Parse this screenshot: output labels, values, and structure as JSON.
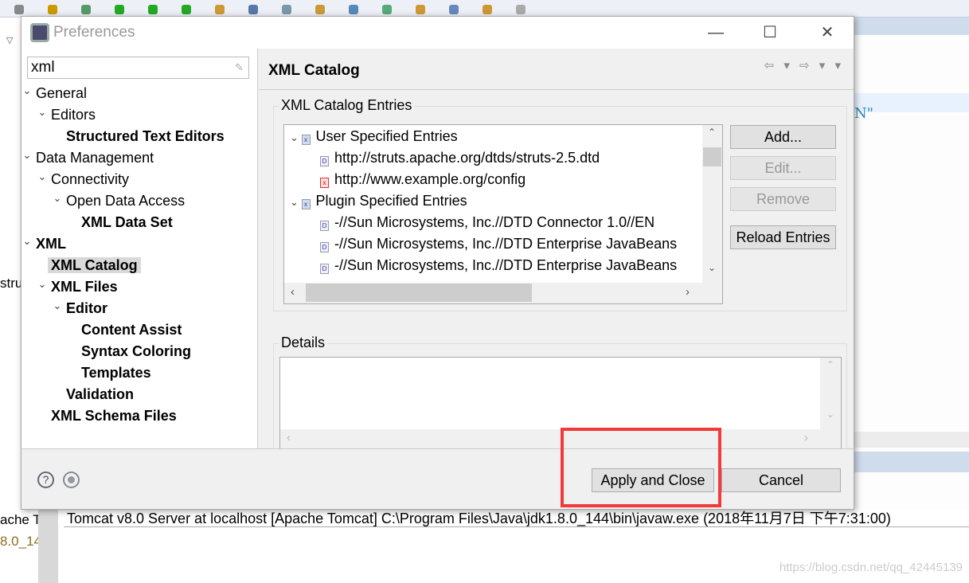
{
  "window": {
    "title": "Preferences",
    "minimize": "—",
    "maximize": "☐",
    "close": "✕"
  },
  "search": {
    "value": "xml"
  },
  "tree": [
    {
      "label": "General",
      "level": 0,
      "expanded": true,
      "bold": false
    },
    {
      "label": "Editors",
      "level": 1,
      "expanded": true,
      "bold": false
    },
    {
      "label": "Structured Text Editors",
      "level": 2,
      "bold": true
    },
    {
      "label": "Data Management",
      "level": 0,
      "expanded": true,
      "bold": false
    },
    {
      "label": "Connectivity",
      "level": 1,
      "expanded": true,
      "bold": false
    },
    {
      "label": "Open Data Access",
      "level": 2,
      "expanded": true,
      "bold": false
    },
    {
      "label": "XML Data Set",
      "level": 3,
      "bold": true
    },
    {
      "label": "XML",
      "level": 0,
      "expanded": true,
      "bold": true
    },
    {
      "label": "XML Catalog",
      "level": 1,
      "bold": true,
      "selected": true
    },
    {
      "label": "XML Files",
      "level": 1,
      "expanded": true,
      "bold": true
    },
    {
      "label": "Editor",
      "level": 2,
      "expanded": true,
      "bold": true
    },
    {
      "label": "Content Assist",
      "level": 3,
      "bold": true
    },
    {
      "label": "Syntax Coloring",
      "level": 3,
      "bold": true
    },
    {
      "label": "Templates",
      "level": 3,
      "bold": true
    },
    {
      "label": "Validation",
      "level": 2,
      "bold": true
    },
    {
      "label": "XML Schema Files",
      "level": 1,
      "bold": true
    }
  ],
  "page": {
    "title": "XML Catalog",
    "nav": "⇦ ▾ ⇨ ▾ ▾"
  },
  "catalog": {
    "group_label": "XML Catalog Entries",
    "entries": [
      {
        "label": "User Specified Entries",
        "group": true
      },
      {
        "label": "http://struts.apache.org/dtds/struts-2.5.dtd",
        "icon": "dtd-file-icon"
      },
      {
        "label": "http://www.example.org/config",
        "icon": "xml-error-file-icon"
      },
      {
        "label": "Plugin Specified Entries",
        "group": true
      },
      {
        "label": "-//Sun Microsystems, Inc.//DTD Connector 1.0//EN",
        "icon": "dtd-file-icon"
      },
      {
        "label": "-//Sun Microsystems, Inc.//DTD Enterprise JavaBeans",
        "icon": "dtd-file-icon"
      },
      {
        "label": "-//Sun Microsystems, Inc.//DTD Enterprise JavaBeans",
        "icon": "dtd-file-icon"
      }
    ],
    "buttons": {
      "add": "Add...",
      "edit": "Edit...",
      "remove": "Remove",
      "reload": "Reload Entries"
    }
  },
  "details": {
    "group_label": "Details"
  },
  "footer": {
    "apply_close": "Apply and Close",
    "cancel": "Cancel",
    "help": "?"
  },
  "background": {
    "console": "Tomcat v8.0 Server at localhost [Apache Tomcat] C:\\Program Files\\Java\\jdk1.8.0_144\\bin\\javaw.exe (2018年11月7日 下午7:31:00)",
    "editor_fragment": "N\"",
    "left_fragments": [
      "stru",
      "ache T",
      "8.0_14"
    ],
    "watermark": "https://blog.csdn.net/qq_42445139"
  },
  "colors": {
    "highlight": "#f23a3a",
    "selection": "#d9d9d9",
    "code": "#2a8fb5"
  }
}
